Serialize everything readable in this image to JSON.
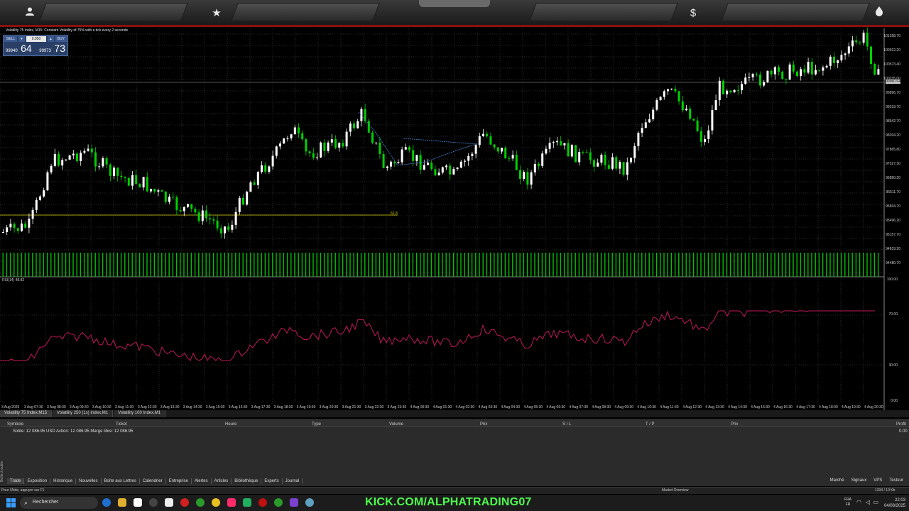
{
  "topbar": {
    "icons": [
      "user-icon",
      "star-icon",
      "dollar-icon",
      "flame-icon"
    ]
  },
  "chart": {
    "title": "Volatility 75 Index, M15:  Constant Volatility of 75% with a tick every 2 seconds",
    "trade_panel": {
      "sell_label": "SELL",
      "buy_label": "BUY",
      "lot": "0.050",
      "sell_price_small": "99940",
      "sell_price_big": "64",
      "buy_price_small": "99973",
      "buy_price_big": "73"
    },
    "price_labels": [
      "101258.70",
      "100912.20",
      "100573.40",
      "100235.00",
      "99896.70",
      "99219.70",
      "98542.70",
      "98204.20",
      "97865.80",
      "97527.30",
      "96850.20",
      "96511.70",
      "95834.70",
      "95496.20",
      "95157.70",
      "94819.20",
      "94480.70"
    ],
    "current_price": "99960.64",
    "fib_label": "61.8",
    "time_labels": [
      "3 Aug 2025",
      "3 Aug 07:30",
      "3 Aug 08:30",
      "3 Aug 09:30",
      "3 Aug 10:30",
      "3 Aug 11:30",
      "3 Aug 12:30",
      "3 Aug 13:30",
      "3 Aug 14:30",
      "3 Aug 15:30",
      "3 Aug 16:30",
      "3 Aug 17:30",
      "3 Aug 18:30",
      "3 Aug 19:30",
      "3 Aug 20:30",
      "3 Aug 21:30",
      "3 Aug 22:30",
      "3 Aug 23:30",
      "4 Aug 00:30",
      "4 Aug 01:30",
      "4 Aug 02:30",
      "4 Aug 03:30",
      "4 Aug 04:30",
      "4 Aug 05:30",
      "4 Aug 06:30",
      "4 Aug 07:30",
      "4 Aug 08:30",
      "4 Aug 09:30",
      "4 Aug 10:30",
      "4 Aug 11:30",
      "4 Aug 12:30",
      "4 Aug 13:30",
      "4 Aug 14:30",
      "4 Aug 15:30",
      "4 Aug 16:30",
      "4 Aug 17:30",
      "4 Aug 18:30",
      "4 Aug 19:30",
      "4 Aug 20:30"
    ],
    "rsi_label": "RSI(14) 48.82",
    "rsi_levels": [
      "100.00",
      "70.00",
      "30.00",
      "0.00"
    ],
    "colors": {
      "bull": "#ffffff",
      "bear": "#00d000",
      "rsi": "#c0185a",
      "volume": "#00c000",
      "grid": "#555555",
      "fib": "#d9d200"
    }
  },
  "chart_tabs": [
    "Volatility 75 Index,M15",
    "Volatility 250 (1s) Index,M1",
    "Volatility 100 Index,M1"
  ],
  "toolbox": {
    "columns": [
      "Symbole",
      "Ticket",
      "Heure",
      "Type",
      "Volume",
      "Prix",
      "S / L",
      "T / P",
      "Prix",
      "Profit"
    ],
    "balance_line": "Solde: 12 086.95 USD  Action: 12 086.95  Marge libre: 12 086.95",
    "profit_value": "0.00",
    "side_label": "Boîte à outils",
    "tabs": [
      "Trade",
      "Exposition",
      "Historique",
      "Nouvelles",
      "Boîte aux Lettres",
      "Calendrier",
      "Entreprise",
      "Alertes",
      "Articles",
      "Bibliothèque",
      "Experts",
      "Journal"
    ],
    "right_links": [
      "Marché",
      "Signaux",
      "VPS",
      "Testeur"
    ]
  },
  "statusbar": {
    "help": "Pour l'Aide, appuyer sur F1",
    "profile": "Market Overview",
    "traffic": "1334 / 10 Kb"
  },
  "taskbar": {
    "search_placeholder": "Rechercher",
    "banner": "KICK.COM/ALPHATRADING07",
    "lang_top": "FRA",
    "lang_bottom": "FR",
    "time": "22:03",
    "date": "04/08/2025"
  }
}
